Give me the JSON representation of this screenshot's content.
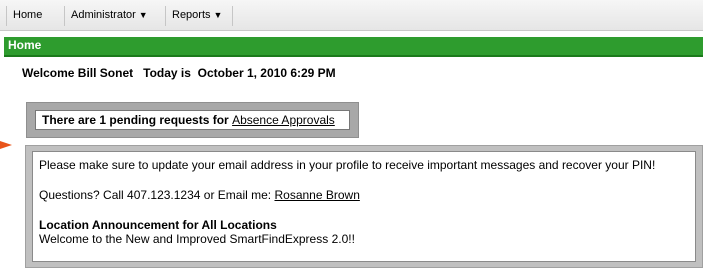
{
  "nav": {
    "home": "Home",
    "administrator": "Administrator",
    "reports": "Reports",
    "caret": "▼"
  },
  "header": {
    "title": "Home"
  },
  "welcome": {
    "greeting": "Welcome Bill Sonet",
    "today_prefix": "Today is",
    "date": "October 1, 2010 6:29 PM"
  },
  "pending": {
    "prefix": "There are 1 pending requests for",
    "link": "Absence Approvals"
  },
  "announcement": {
    "message": "Please make sure to update your email address in your profile to receive important messages and recover your PIN!",
    "questions_prefix": "Questions? Call 407.123.1234 or Email me:",
    "contact_link": "Rosanne Brown",
    "title": "Location Announcement for All Locations",
    "body": "Welcome to the New and Improved SmartFindExpress 2.0!!"
  },
  "colors": {
    "accent_green": "#2e9c2e",
    "arrow_orange": "#e8541b"
  }
}
